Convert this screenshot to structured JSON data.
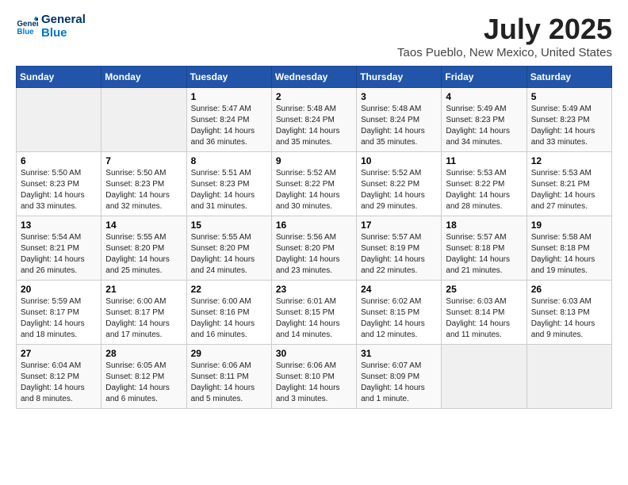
{
  "logo": {
    "line1": "General",
    "line2": "Blue"
  },
  "title": "July 2025",
  "subtitle": "Taos Pueblo, New Mexico, United States",
  "weekdays": [
    "Sunday",
    "Monday",
    "Tuesday",
    "Wednesday",
    "Thursday",
    "Friday",
    "Saturday"
  ],
  "weeks": [
    [
      {
        "num": "",
        "info": ""
      },
      {
        "num": "",
        "info": ""
      },
      {
        "num": "1",
        "info": "Sunrise: 5:47 AM\nSunset: 8:24 PM\nDaylight: 14 hours\nand 36 minutes."
      },
      {
        "num": "2",
        "info": "Sunrise: 5:48 AM\nSunset: 8:24 PM\nDaylight: 14 hours\nand 35 minutes."
      },
      {
        "num": "3",
        "info": "Sunrise: 5:48 AM\nSunset: 8:24 PM\nDaylight: 14 hours\nand 35 minutes."
      },
      {
        "num": "4",
        "info": "Sunrise: 5:49 AM\nSunset: 8:23 PM\nDaylight: 14 hours\nand 34 minutes."
      },
      {
        "num": "5",
        "info": "Sunrise: 5:49 AM\nSunset: 8:23 PM\nDaylight: 14 hours\nand 33 minutes."
      }
    ],
    [
      {
        "num": "6",
        "info": "Sunrise: 5:50 AM\nSunset: 8:23 PM\nDaylight: 14 hours\nand 33 minutes."
      },
      {
        "num": "7",
        "info": "Sunrise: 5:50 AM\nSunset: 8:23 PM\nDaylight: 14 hours\nand 32 minutes."
      },
      {
        "num": "8",
        "info": "Sunrise: 5:51 AM\nSunset: 8:23 PM\nDaylight: 14 hours\nand 31 minutes."
      },
      {
        "num": "9",
        "info": "Sunrise: 5:52 AM\nSunset: 8:22 PM\nDaylight: 14 hours\nand 30 minutes."
      },
      {
        "num": "10",
        "info": "Sunrise: 5:52 AM\nSunset: 8:22 PM\nDaylight: 14 hours\nand 29 minutes."
      },
      {
        "num": "11",
        "info": "Sunrise: 5:53 AM\nSunset: 8:22 PM\nDaylight: 14 hours\nand 28 minutes."
      },
      {
        "num": "12",
        "info": "Sunrise: 5:53 AM\nSunset: 8:21 PM\nDaylight: 14 hours\nand 27 minutes."
      }
    ],
    [
      {
        "num": "13",
        "info": "Sunrise: 5:54 AM\nSunset: 8:21 PM\nDaylight: 14 hours\nand 26 minutes."
      },
      {
        "num": "14",
        "info": "Sunrise: 5:55 AM\nSunset: 8:20 PM\nDaylight: 14 hours\nand 25 minutes."
      },
      {
        "num": "15",
        "info": "Sunrise: 5:55 AM\nSunset: 8:20 PM\nDaylight: 14 hours\nand 24 minutes."
      },
      {
        "num": "16",
        "info": "Sunrise: 5:56 AM\nSunset: 8:20 PM\nDaylight: 14 hours\nand 23 minutes."
      },
      {
        "num": "17",
        "info": "Sunrise: 5:57 AM\nSunset: 8:19 PM\nDaylight: 14 hours\nand 22 minutes."
      },
      {
        "num": "18",
        "info": "Sunrise: 5:57 AM\nSunset: 8:18 PM\nDaylight: 14 hours\nand 21 minutes."
      },
      {
        "num": "19",
        "info": "Sunrise: 5:58 AM\nSunset: 8:18 PM\nDaylight: 14 hours\nand 19 minutes."
      }
    ],
    [
      {
        "num": "20",
        "info": "Sunrise: 5:59 AM\nSunset: 8:17 PM\nDaylight: 14 hours\nand 18 minutes."
      },
      {
        "num": "21",
        "info": "Sunrise: 6:00 AM\nSunset: 8:17 PM\nDaylight: 14 hours\nand 17 minutes."
      },
      {
        "num": "22",
        "info": "Sunrise: 6:00 AM\nSunset: 8:16 PM\nDaylight: 14 hours\nand 16 minutes."
      },
      {
        "num": "23",
        "info": "Sunrise: 6:01 AM\nSunset: 8:15 PM\nDaylight: 14 hours\nand 14 minutes."
      },
      {
        "num": "24",
        "info": "Sunrise: 6:02 AM\nSunset: 8:15 PM\nDaylight: 14 hours\nand 12 minutes."
      },
      {
        "num": "25",
        "info": "Sunrise: 6:03 AM\nSunset: 8:14 PM\nDaylight: 14 hours\nand 11 minutes."
      },
      {
        "num": "26",
        "info": "Sunrise: 6:03 AM\nSunset: 8:13 PM\nDaylight: 14 hours\nand 9 minutes."
      }
    ],
    [
      {
        "num": "27",
        "info": "Sunrise: 6:04 AM\nSunset: 8:12 PM\nDaylight: 14 hours\nand 8 minutes."
      },
      {
        "num": "28",
        "info": "Sunrise: 6:05 AM\nSunset: 8:12 PM\nDaylight: 14 hours\nand 6 minutes."
      },
      {
        "num": "29",
        "info": "Sunrise: 6:06 AM\nSunset: 8:11 PM\nDaylight: 14 hours\nand 5 minutes."
      },
      {
        "num": "30",
        "info": "Sunrise: 6:06 AM\nSunset: 8:10 PM\nDaylight: 14 hours\nand 3 minutes."
      },
      {
        "num": "31",
        "info": "Sunrise: 6:07 AM\nSunset: 8:09 PM\nDaylight: 14 hours\nand 1 minute."
      },
      {
        "num": "",
        "info": ""
      },
      {
        "num": "",
        "info": ""
      }
    ]
  ]
}
